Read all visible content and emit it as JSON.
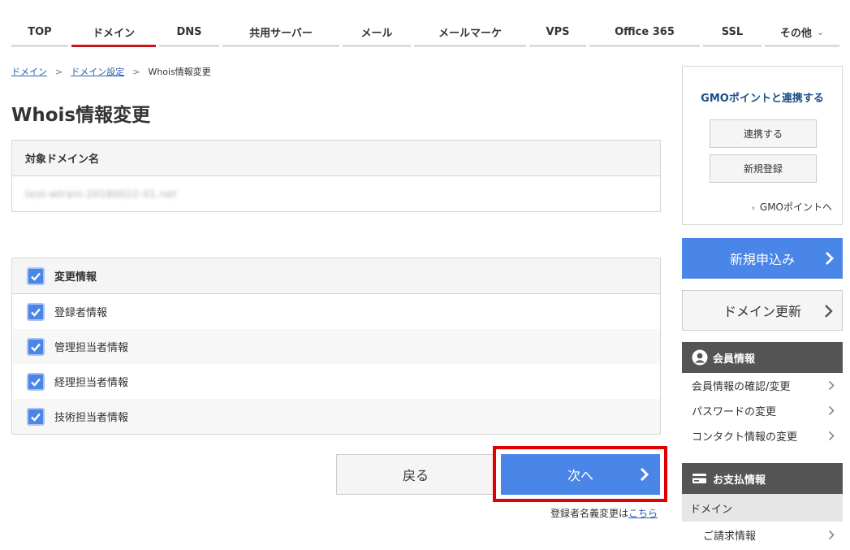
{
  "nav": {
    "items": [
      {
        "label": "TOP"
      },
      {
        "label": "ドメイン"
      },
      {
        "label": "DNS"
      },
      {
        "label": "共用サーバー"
      },
      {
        "label": "メール"
      },
      {
        "label": "メールマーケ"
      },
      {
        "label": "VPS"
      },
      {
        "label": "Office 365"
      },
      {
        "label": "SSL"
      },
      {
        "label": "その他"
      }
    ],
    "active_index": 1
  },
  "breadcrumb": {
    "items": [
      "ドメイン",
      "ドメイン設定",
      "Whois情報変更"
    ]
  },
  "page": {
    "title": "Whois情報変更"
  },
  "domain": {
    "header": "対象ドメイン名",
    "value": "test-wtrain-20180022-01.net"
  },
  "changes": {
    "header": "変更情報",
    "items": [
      {
        "label": "登録者情報",
        "checked": true
      },
      {
        "label": "管理担当者情報",
        "checked": true
      },
      {
        "label": "経理担当者情報",
        "checked": true
      },
      {
        "label": "技術担当者情報",
        "checked": true
      }
    ],
    "header_checked": true
  },
  "actions": {
    "back_label": "戻る",
    "next_label": "次へ",
    "note_prefix": "登録者名義変更は",
    "note_link": "こちら"
  },
  "sidebar": {
    "gmo": {
      "title": "GMOポイントと連携する",
      "link_button": "連携する",
      "register_button": "新規登録",
      "points_link": "GMOポイントへ"
    },
    "new_application": "新規申込み",
    "domain_renewal": "ドメイン更新",
    "member": {
      "title": "会員情報",
      "items": [
        "会員情報の確認/変更",
        "パスワードの変更",
        "コンタクト情報の変更"
      ]
    },
    "payment": {
      "title": "お支払情報",
      "sub": "ドメイン",
      "items": [
        "ご請求情報"
      ]
    }
  },
  "colors": {
    "accent_red": "#c8161d",
    "primary_blue": "#4a86e8",
    "highlight_red": "#e00000"
  }
}
